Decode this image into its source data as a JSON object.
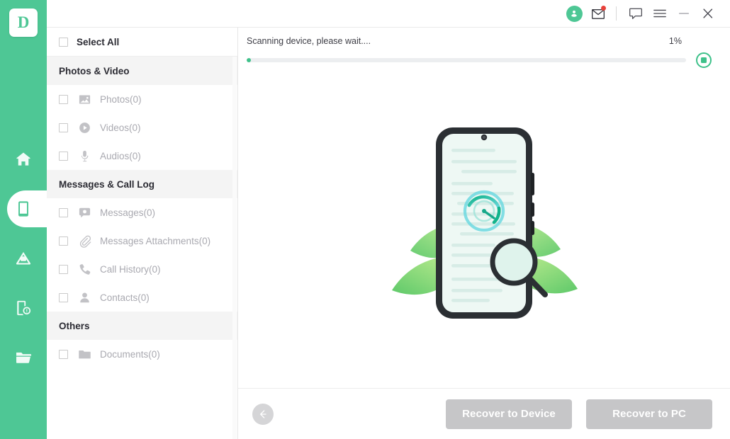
{
  "app": {
    "logo_letter": "D",
    "accent_color": "#4ec795",
    "progress_color": "#3ec18a",
    "disabled_button_color": "#c6c6c8"
  },
  "rail": {
    "items": [
      {
        "name": "home",
        "icon": "home-icon",
        "active": false
      },
      {
        "name": "device",
        "icon": "phone-icon",
        "active": true
      },
      {
        "name": "cloud",
        "icon": "cloud-icon",
        "active": false
      },
      {
        "name": "device-repair",
        "icon": "device-info-icon",
        "active": false
      },
      {
        "name": "files",
        "icon": "folder-icon",
        "active": false
      }
    ]
  },
  "titlebar": {
    "account_icon": "account-circle-icon",
    "mail_icon": "mail-icon",
    "mail_has_badge": true,
    "feedback_icon": "chat-bubble-icon",
    "menu_icon": "hamburger-menu-icon",
    "minimize_icon": "minimize-icon",
    "close_icon": "close-icon"
  },
  "filelist": {
    "select_all_label": "Select All",
    "sections": [
      {
        "title": "Photos & Video",
        "items": [
          {
            "label": "Photos(0)",
            "icon": "image-icon",
            "name": "photos"
          },
          {
            "label": "Videos(0)",
            "icon": "video-play-icon",
            "name": "videos"
          },
          {
            "label": "Audios(0)",
            "icon": "microphone-icon",
            "name": "audios"
          }
        ]
      },
      {
        "title": "Messages & Call Log",
        "items": [
          {
            "label": "Messages(0)",
            "icon": "message-bubble-icon",
            "name": "messages"
          },
          {
            "label": "Messages Attachments(0)",
            "icon": "paperclip-icon",
            "name": "messages-attachments"
          },
          {
            "label": "Call History(0)",
            "icon": "phone-handset-icon",
            "name": "call-history"
          },
          {
            "label": "Contacts(0)",
            "icon": "person-icon",
            "name": "contacts"
          }
        ]
      },
      {
        "title": "Others",
        "items": [
          {
            "label": "Documents(0)",
            "icon": "folder-filled-icon",
            "name": "documents"
          }
        ]
      }
    ]
  },
  "progress": {
    "message": "Scanning device, please wait....",
    "percent_label": "1%",
    "percent_value": 1,
    "stop_icon": "stop-scan-icon"
  },
  "illustration": {
    "name": "phone-scanning-illustration",
    "description": "smartphone with document lines, scanning dial, magnifying glass and green leaves"
  },
  "bottombar": {
    "back_icon": "back-arrow-icon",
    "recover_to_device_label": "Recover to Device",
    "recover_to_pc_label": "Recover to PC"
  }
}
